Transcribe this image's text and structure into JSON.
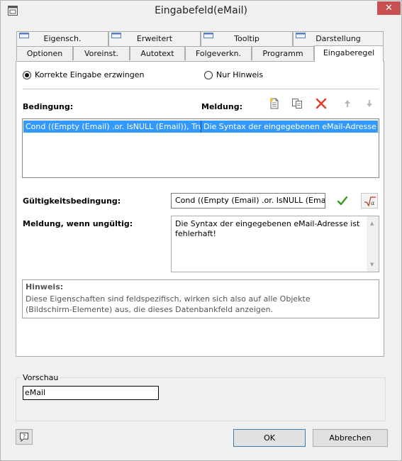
{
  "window": {
    "title": "Eingabefeld(eMail)"
  },
  "tabs": {
    "row_back": [
      "Eigensch.",
      "Erweitert",
      "Tooltip",
      "Darstellung"
    ],
    "row_front": [
      "Optionen",
      "Voreinst.",
      "Autotext",
      "Folgeverkn.",
      "Programm",
      "Eingaberegel"
    ],
    "active": "Eingaberegel"
  },
  "mode": {
    "option1": "Korrekte Eingabe erzwingen",
    "option2": "Nur Hinweis",
    "selected": "Korrekte Eingabe erzwingen"
  },
  "rules": {
    "condition_header": "Bedingung:",
    "message_header": "Meldung:",
    "toolbar_icons": [
      "new-icon",
      "copy-icon",
      "delete-icon",
      "arrow-up-icon",
      "arrow-down-icon"
    ],
    "rows": [
      {
        "condition": "Cond ((Empty (Email) .or. IsNULL (Email)), True,",
        "message": "Die Syntax der eingegebenen eMail-Adresse ist"
      }
    ]
  },
  "validity": {
    "label": "Gültigkeitsbedingung:",
    "value": "Cond ((Empty (Email) .or. IsNULL (Emai",
    "invalid_label": "Meldung, wenn ungültig:",
    "invalid_message": "Die Syntax der eingegebenen eMail-Adresse ist fehlerhaft!"
  },
  "hint": {
    "title": "Hinweis:",
    "text": "Diese Eigenschaften sind feldspezifisch, wirken sich also auf alle Objekte (Bildschirm-Elemente) aus, die dieses Datenbankfeld anzeigen."
  },
  "preview": {
    "label": "Vorschau",
    "value": "eMail"
  },
  "buttons": {
    "ok": "OK",
    "cancel": "Abbrechen"
  },
  "colors": {
    "selection": "#3399ff",
    "close": "#c75050",
    "check": "#3a9a1a",
    "delete": "#e0402a"
  }
}
